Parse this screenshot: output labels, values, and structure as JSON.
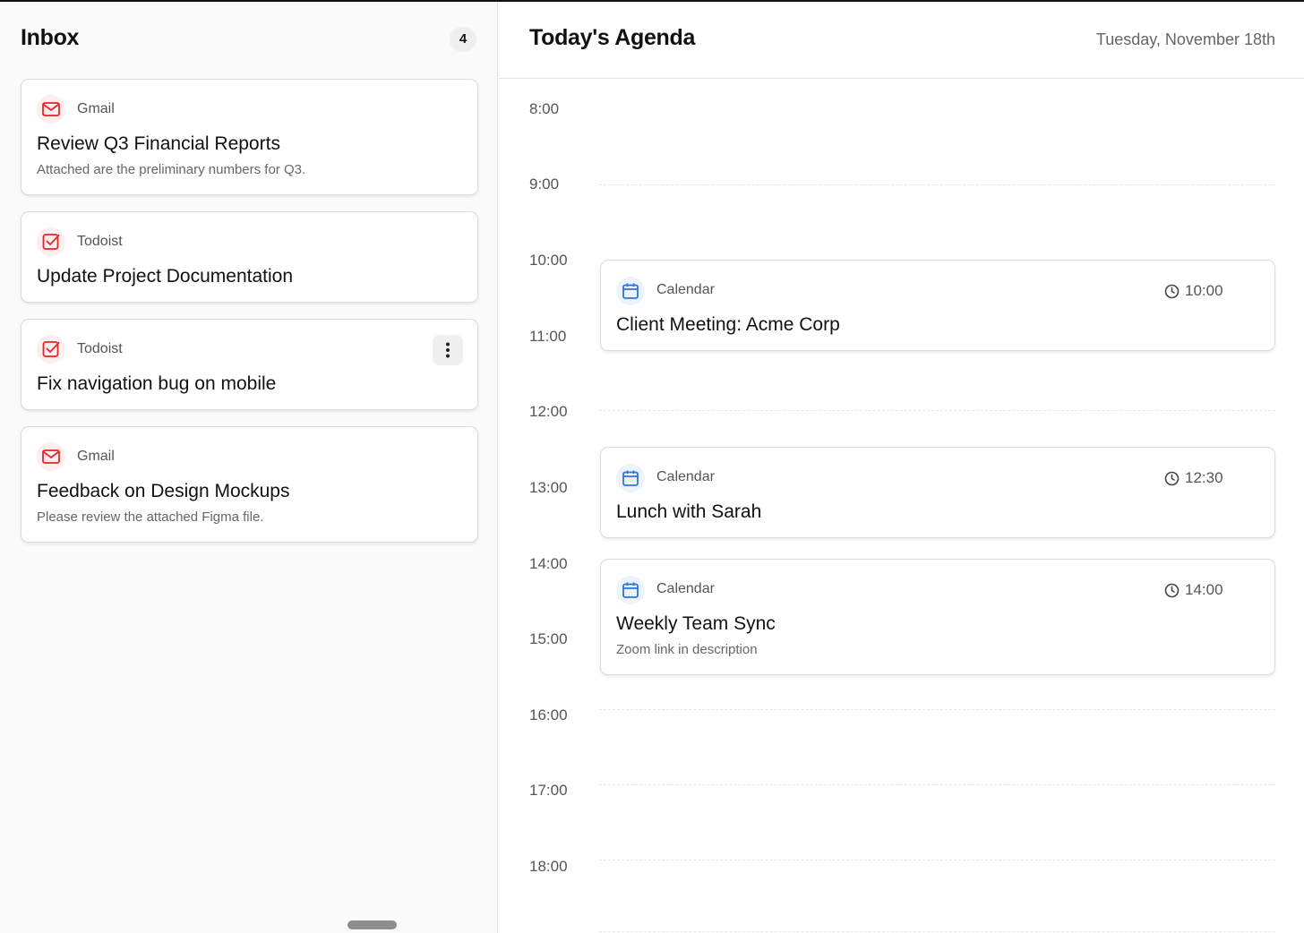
{
  "inbox": {
    "title": "Inbox",
    "count": "4",
    "items": [
      {
        "source": "Gmail",
        "title": "Review Q3 Financial Reports",
        "subtitle": "Attached are the preliminary numbers for Q3.",
        "icon": "mail-icon"
      },
      {
        "source": "Todoist",
        "title": "Update Project Documentation",
        "subtitle": "",
        "icon": "checkbox-icon"
      },
      {
        "source": "Todoist",
        "title": "Fix navigation bug on mobile",
        "subtitle": "",
        "icon": "checkbox-icon",
        "has_menu": true
      },
      {
        "source": "Gmail",
        "title": "Feedback on Design Mockups",
        "subtitle": "Please review the attached Figma file.",
        "icon": "mail-icon"
      }
    ]
  },
  "agenda": {
    "title": "Today's Agenda",
    "date": "Tuesday, November 18th",
    "hours": [
      "8:00",
      "9:00",
      "10:00",
      "11:00",
      "12:00",
      "13:00",
      "14:00",
      "15:00",
      "16:00",
      "17:00",
      "18:00"
    ],
    "events": [
      {
        "source": "Calendar",
        "title": "Client Meeting: Acme Corp",
        "time": "10:00",
        "subtitle": ""
      },
      {
        "source": "Calendar",
        "title": "Lunch with Sarah",
        "time": "12:30",
        "subtitle": ""
      },
      {
        "source": "Calendar",
        "title": "Weekly Team Sync",
        "time": "14:00",
        "subtitle": "Zoom link in description"
      }
    ]
  },
  "colors": {
    "accent_red": "#e0262b",
    "accent_blue": "#2f74d9"
  }
}
